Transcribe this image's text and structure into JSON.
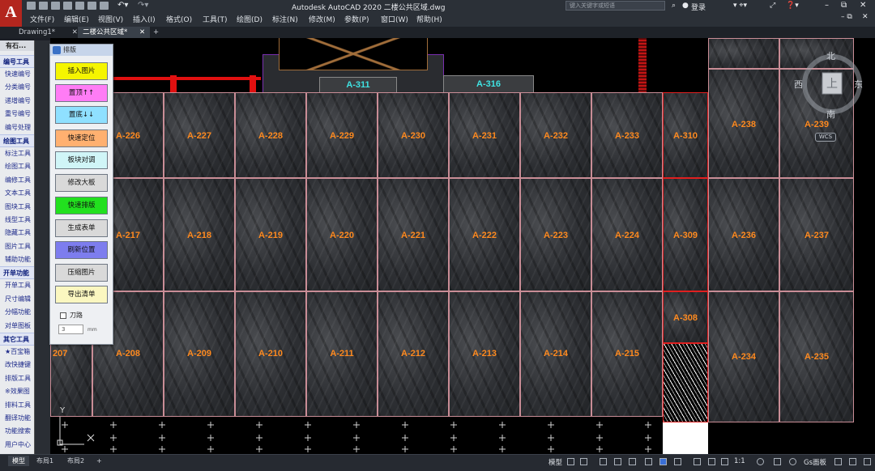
{
  "app": {
    "title": "Autodesk AutoCAD 2020    二楼公共区域.dwg",
    "logo": "A",
    "search_placeholder": "键入关键字或短语",
    "signin": "登录"
  },
  "menu": [
    "文件(F)",
    "编辑(E)",
    "视图(V)",
    "插入(I)",
    "格式(O)",
    "工具(T)",
    "绘图(D)",
    "标注(N)",
    "修改(M)",
    "参数(P)",
    "窗口(W)",
    "帮助(H)"
  ],
  "tabs": [
    {
      "label": "Drawing1*",
      "close": "✕"
    },
    {
      "label": "二楼公共区域*",
      "close": "✕"
    },
    {
      "label": "+"
    }
  ],
  "left_panel": {
    "title": "有石...",
    "groups": [
      {
        "head": "编号工具",
        "items": [
          "快速编号",
          "分类编号",
          "递增编号",
          "重号编号",
          "编号处理"
        ]
      },
      {
        "head": "绘图工具",
        "items": [
          "标注工具",
          "绘图工具",
          "编修工具",
          "文本工具",
          "图块工具",
          "线型工具",
          "隐藏工具",
          "图片工具",
          "辅助功能"
        ]
      },
      {
        "head": "开单功能",
        "items": [
          "开单工具",
          "尺寸编辑",
          "分幅功能",
          "对单图板"
        ]
      },
      {
        "head": "其它工具",
        "items": [
          "★百宝箱",
          "改快捷键",
          "排版工具",
          "※效果图",
          "排料工具",
          "翻译功能",
          "功能搜索",
          "用户中心"
        ]
      }
    ]
  },
  "dialog": {
    "title": "排版",
    "buttons": [
      {
        "label": "插入图片",
        "color": "#f5f500"
      },
      {
        "label": "置顶↑↑",
        "color": "#ff7cf5"
      },
      {
        "label": "置底↓↓",
        "color": "#8fe0ff"
      },
      {
        "label": "快速定位",
        "color": "#ffb070"
      },
      {
        "label": "板块对调",
        "color": "#d0f5f7"
      },
      {
        "label": "修改大板",
        "color": "#d9d9d9"
      },
      {
        "label": "快速排版",
        "color": "#22e01f"
      },
      {
        "label": "生成表单",
        "color": "#d9d9d9"
      },
      {
        "label": "刷新位置",
        "color": "#7d7dee"
      },
      {
        "label": "压缩图片",
        "color": "#d9d9d9"
      },
      {
        "label": "导出清单",
        "color": "#fbf7c0"
      }
    ],
    "checkbox_label": "刀路",
    "input_value": "3",
    "unit": "mm"
  },
  "drawing": {
    "rooms": [
      "A-311",
      "A-316"
    ],
    "row1": [
      "A-226",
      "A-227",
      "A-228",
      "A-229",
      "A-230",
      "A-231",
      "A-232",
      "A-233",
      "A-310",
      "A-238",
      "A-239"
    ],
    "row2": [
      "A-217",
      "A-218",
      "A-219",
      "A-220",
      "A-221",
      "A-222",
      "A-223",
      "A-224",
      "A-309",
      "A-236",
      "A-237"
    ],
    "row3": [
      "207",
      "A-208",
      "A-209",
      "A-210",
      "A-211",
      "A-212",
      "A-213",
      "A-214",
      "A-215",
      "A-308",
      "A-234",
      "A-235"
    ],
    "ucs_label": "Y"
  },
  "viewcube": {
    "top": "上",
    "north": "北",
    "south": "南",
    "east": "东",
    "west": "西",
    "wcs": "WCS"
  },
  "status": {
    "tabs": [
      "模型",
      "布局1",
      "布局2",
      "+"
    ],
    "model_label": "模型",
    "scale": "1:1",
    "workspace": "Gs面板"
  }
}
